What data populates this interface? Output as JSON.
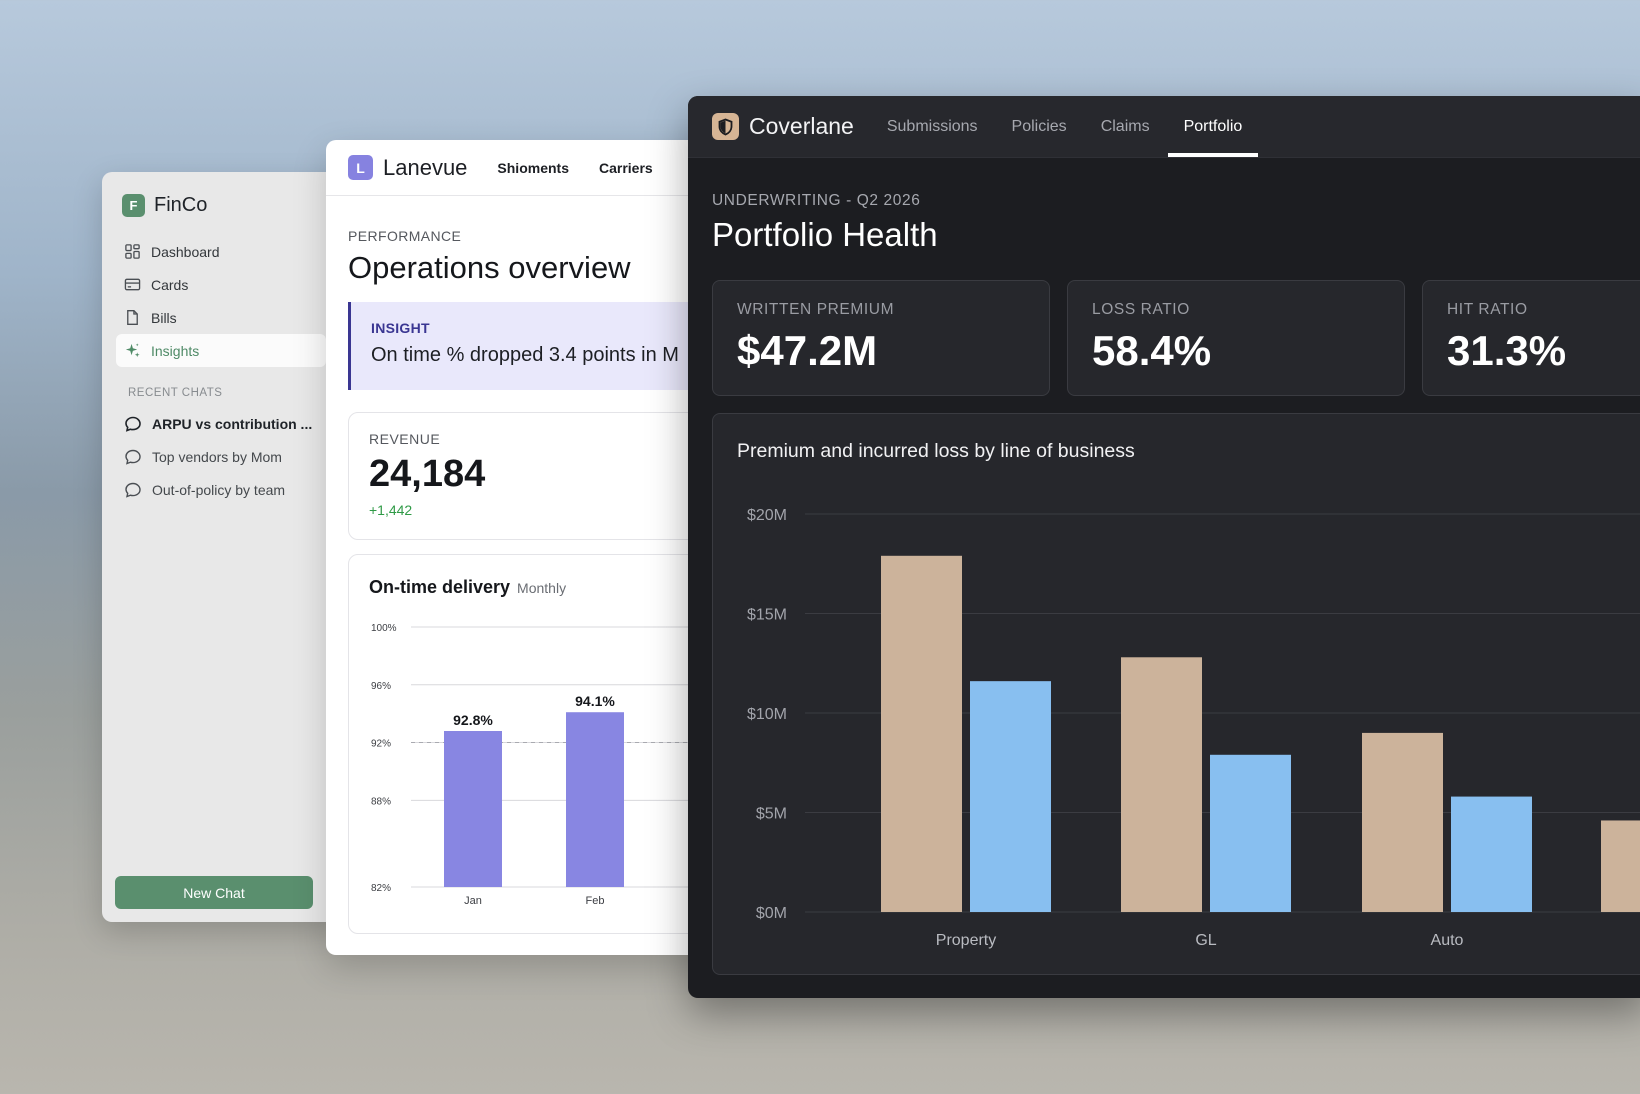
{
  "finco": {
    "logo_letter": "F",
    "brand": "FinCo",
    "nav": [
      {
        "label": "Dashboard",
        "icon": "grid-icon"
      },
      {
        "label": "Cards",
        "icon": "card-icon"
      },
      {
        "label": "Bills",
        "icon": "document-icon"
      },
      {
        "label": "Insights",
        "icon": "sparkle-icon",
        "active": true
      }
    ],
    "recent_label": "RECENT CHATS",
    "chats": [
      "ARPU vs contribution ...",
      "Top vendors by Mom",
      "Out-of-policy by team"
    ],
    "new_chat": "New Chat"
  },
  "lanevue": {
    "logo_letter": "L",
    "brand": "Lanevue",
    "tabs": [
      "Shioments",
      "Carriers"
    ],
    "eyebrow": "PERFORMANCE",
    "title": "Operations overview",
    "insight": {
      "label": "INSIGHT",
      "text": "On time % dropped 3.4 points in M"
    },
    "revenue": {
      "label": "REVENUE",
      "value": "24,184",
      "delta": "+1,442"
    },
    "chart_title": "On-time delivery",
    "chart_subtitle": "Monthly",
    "colors": {
      "bar": "#8886e2",
      "accent": "#3a3692"
    }
  },
  "coverlane": {
    "brand": "Coverlane",
    "tabs": [
      "Submissions",
      "Policies",
      "Claims",
      "Portfolio"
    ],
    "active_tab": "Portfolio",
    "eyebrow": "UNDERWRITING - Q2 2026",
    "title": "Portfolio Health",
    "kpis": [
      {
        "label": "WRITTEN PREMIUM",
        "value": "$47.2M"
      },
      {
        "label": "LOSS RATIO",
        "value": "58.4%"
      },
      {
        "label": "HIT RATIO",
        "value": "31.3%"
      }
    ],
    "chart_title": "Premium and incurred loss by line of business",
    "colors": {
      "premium": "#ccb39b",
      "loss": "#88bff0"
    }
  },
  "chart_data": [
    {
      "type": "bar",
      "title": "On-time delivery",
      "subtitle": "Monthly",
      "categories": [
        "Jan",
        "Feb"
      ],
      "values": [
        92.8,
        94.1
      ],
      "data_labels": [
        "92.8%",
        "94.1%"
      ],
      "ylim": [
        82,
        100
      ],
      "yticks": [
        82,
        88,
        92,
        96,
        100
      ],
      "ytick_labels": [
        "82%",
        "88%",
        "92%",
        "96%",
        "100%"
      ],
      "reference_line": 92,
      "grid": true
    },
    {
      "type": "bar",
      "title": "Premium and incurred loss by line of business",
      "categories": [
        "Property",
        "GL",
        "Auto",
        ""
      ],
      "series": [
        {
          "values": [
            17.9,
            12.8,
            9.0,
            4.6
          ]
        },
        {
          "values": [
            11.6,
            7.9,
            5.8,
            null
          ]
        }
      ],
      "ylim": [
        0,
        20
      ],
      "yticks": [
        0,
        5,
        10,
        15,
        20
      ],
      "ytick_labels": [
        "$0M",
        "$5M",
        "$10M",
        "$15M",
        "$20M"
      ],
      "grid": true
    }
  ]
}
